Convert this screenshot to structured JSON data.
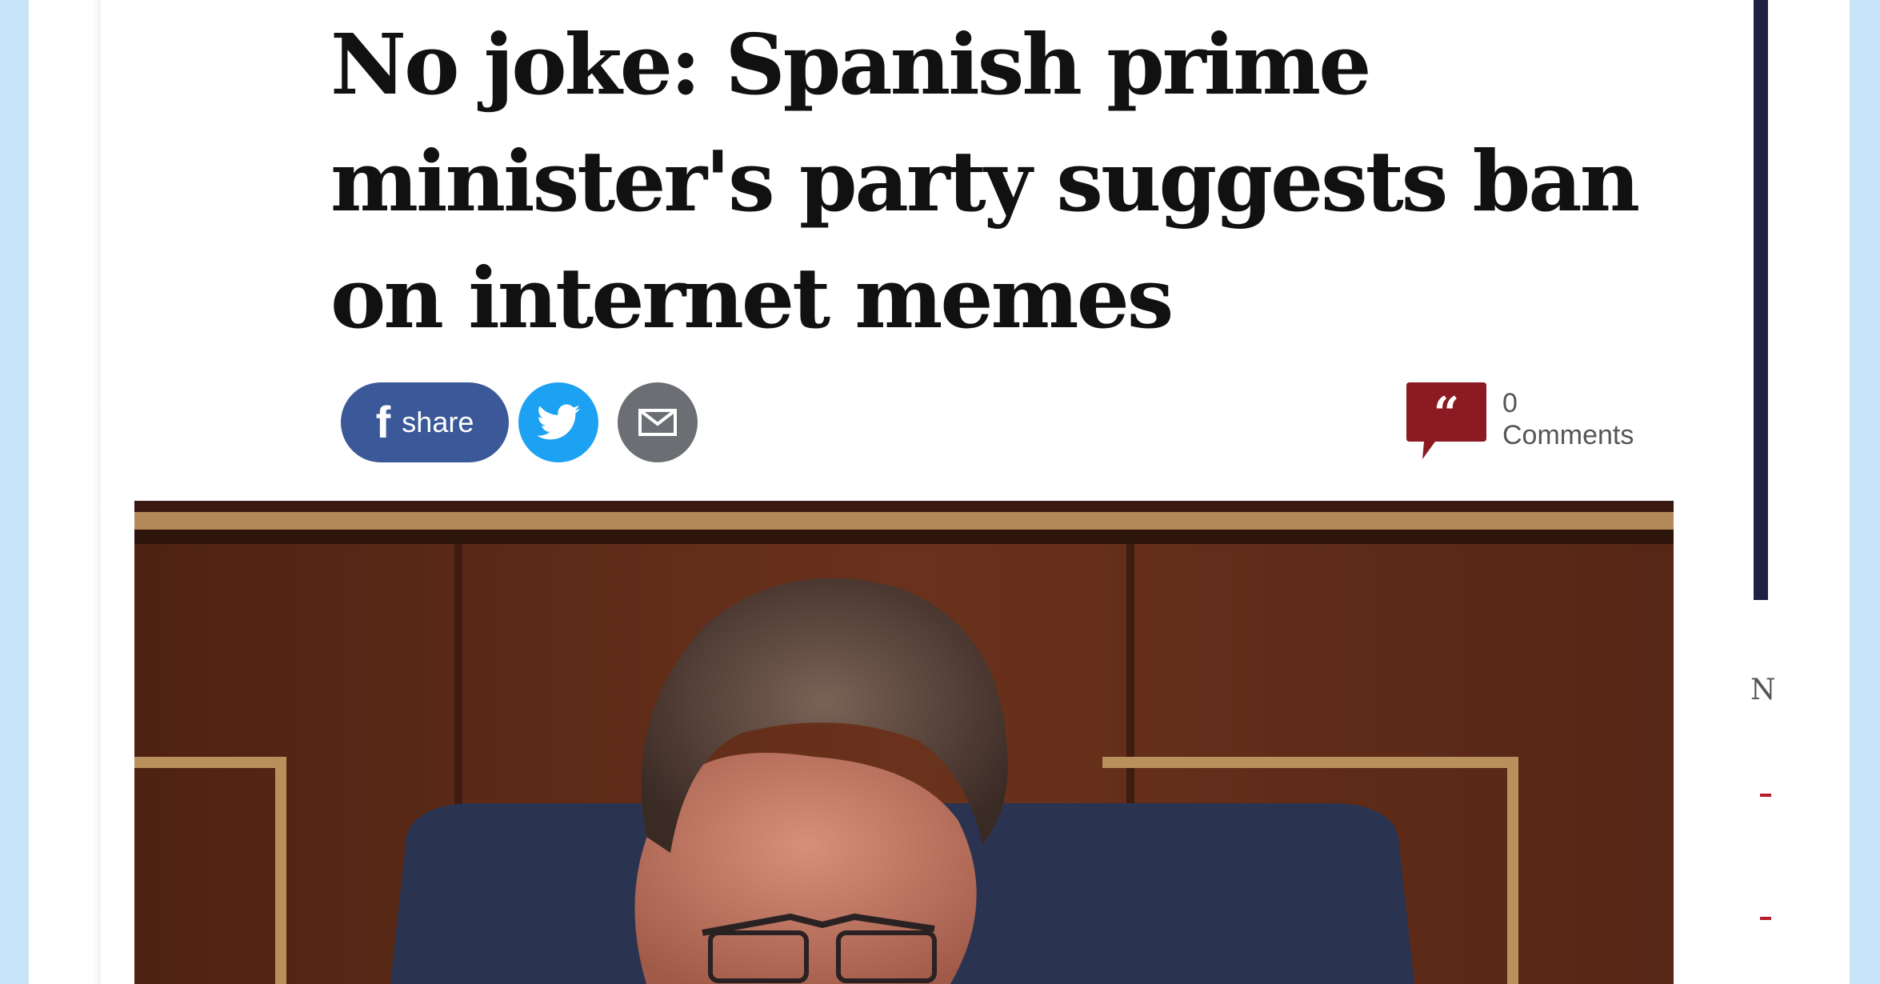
{
  "article": {
    "headline": "No joke: Spanish prime minister's party suggests ban on internet memes"
  },
  "share": {
    "facebook_glyph": "f",
    "facebook_label": "share",
    "twitter_icon": "twitter-bird-icon",
    "email_icon": "envelope-icon"
  },
  "comments": {
    "count": "0",
    "label": "Comments",
    "icon": "speech-bubble-quote-icon"
  },
  "sidebar": {
    "letter": "N"
  },
  "colors": {
    "facebook": "#3b5998",
    "twitter": "#1da1f2",
    "email": "#6b6e72",
    "comments_icon": "#8b1a22",
    "background": "#c8e4f8",
    "rail_rule": "#1d2244"
  }
}
